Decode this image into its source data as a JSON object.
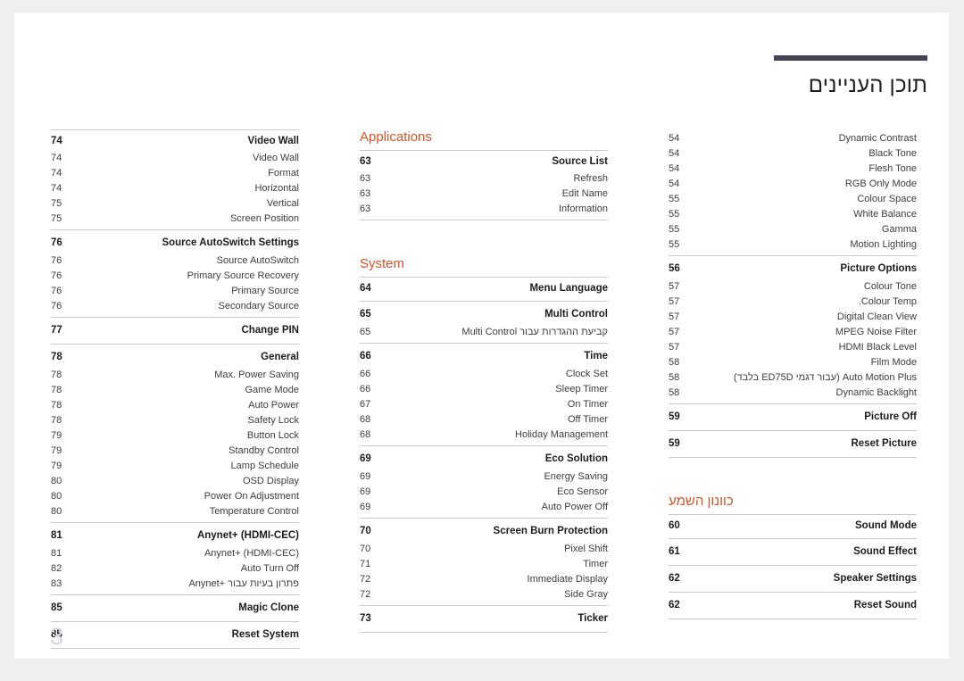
{
  "header": {
    "title": "תוכן העניינים"
  },
  "page_number": "3",
  "colors": {
    "accent": "#d0552a",
    "header_rule": "#454455",
    "text": "#333336",
    "rule": "#c9c9c9",
    "page_number": "#d5d7dc",
    "page_background": "#ffffff",
    "canvas_background": "#efefef"
  },
  "columns": [
    {
      "name": "left-column",
      "sections": [
        {
          "heading": null,
          "groups": [
            {
              "rows": [
                {
                  "page": "74",
                  "label": "Video Wall",
                  "bold": true
                },
                {
                  "page": "74",
                  "label": "Video Wall",
                  "bold": false
                },
                {
                  "page": "74",
                  "label": "Format",
                  "bold": false
                },
                {
                  "page": "74",
                  "label": "Horizontal",
                  "bold": false
                },
                {
                  "page": "75",
                  "label": "Vertical",
                  "bold": false
                },
                {
                  "page": "75",
                  "label": "Screen Position",
                  "bold": false
                }
              ]
            },
            {
              "rows": [
                {
                  "page": "76",
                  "label": "Source AutoSwitch Settings",
                  "bold": true
                },
                {
                  "page": "76",
                  "label": "Source AutoSwitch",
                  "bold": false
                },
                {
                  "page": "76",
                  "label": "Primary Source Recovery",
                  "bold": false
                },
                {
                  "page": "76",
                  "label": "Primary Source",
                  "bold": false
                },
                {
                  "page": "76",
                  "label": "Secondary Source",
                  "bold": false
                }
              ]
            },
            {
              "rows": [
                {
                  "page": "77",
                  "label": "Change PIN",
                  "bold": true
                }
              ]
            },
            {
              "rows": [
                {
                  "page": "78",
                  "label": "General",
                  "bold": true
                },
                {
                  "page": "78",
                  "label": "Max. Power Saving",
                  "bold": false
                },
                {
                  "page": "78",
                  "label": "Game Mode",
                  "bold": false
                },
                {
                  "page": "78",
                  "label": "Auto Power",
                  "bold": false
                },
                {
                  "page": "78",
                  "label": "Safety Lock",
                  "bold": false
                },
                {
                  "page": "79",
                  "label": "Button Lock",
                  "bold": false
                },
                {
                  "page": "79",
                  "label": "Standby Control",
                  "bold": false
                },
                {
                  "page": "79",
                  "label": "Lamp Schedule",
                  "bold": false
                },
                {
                  "page": "80",
                  "label": "OSD Display",
                  "bold": false
                },
                {
                  "page": "80",
                  "label": "Power On Adjustment",
                  "bold": false
                },
                {
                  "page": "80",
                  "label": "Temperature Control",
                  "bold": false
                }
              ]
            },
            {
              "rows": [
                {
                  "page": "81",
                  "label": "Anynet+ (HDMI-CEC)",
                  "bold": true
                },
                {
                  "page": "81",
                  "label": "Anynet+ (HDMI-CEC)",
                  "bold": false
                },
                {
                  "page": "82",
                  "label": "Auto Turn Off",
                  "bold": false
                },
                {
                  "page": "83",
                  "label": "פתרון בעיות עבור +Anynet",
                  "bold": false
                }
              ]
            },
            {
              "rows": [
                {
                  "page": "85",
                  "label": "Magic Clone",
                  "bold": true
                }
              ]
            },
            {
              "rows": [
                {
                  "page": "85",
                  "label": "Reset System",
                  "bold": true
                }
              ]
            }
          ]
        }
      ]
    },
    {
      "name": "middle-column",
      "sections": [
        {
          "heading": "Applications",
          "groups": [
            {
              "rows": [
                {
                  "page": "63",
                  "label": "Source List",
                  "bold": true
                },
                {
                  "page": "63",
                  "label": "Refresh",
                  "bold": false
                },
                {
                  "page": "63",
                  "label": "Edit Name",
                  "bold": false
                },
                {
                  "page": "63",
                  "label": "Information",
                  "bold": false
                }
              ]
            }
          ]
        },
        {
          "heading": "System",
          "groups": [
            {
              "rows": [
                {
                  "page": "64",
                  "label": "Menu Language",
                  "bold": true
                }
              ]
            },
            {
              "rows": [
                {
                  "page": "65",
                  "label": "Multi Control",
                  "bold": true
                },
                {
                  "page": "65",
                  "label": "קביעת ההגדרות עבור Multi Control",
                  "bold": false
                }
              ]
            },
            {
              "rows": [
                {
                  "page": "66",
                  "label": "Time",
                  "bold": true
                },
                {
                  "page": "66",
                  "label": "Clock Set",
                  "bold": false
                },
                {
                  "page": "66",
                  "label": "Sleep Timer",
                  "bold": false
                },
                {
                  "page": "67",
                  "label": "On Timer",
                  "bold": false
                },
                {
                  "page": "68",
                  "label": "Off Timer",
                  "bold": false
                },
                {
                  "page": "68",
                  "label": "Holiday Management",
                  "bold": false
                }
              ]
            },
            {
              "rows": [
                {
                  "page": "69",
                  "label": "Eco Solution",
                  "bold": true
                },
                {
                  "page": "69",
                  "label": "Energy Saving",
                  "bold": false
                },
                {
                  "page": "69",
                  "label": "Eco Sensor",
                  "bold": false
                },
                {
                  "page": "69",
                  "label": "Auto Power Off",
                  "bold": false
                }
              ]
            },
            {
              "rows": [
                {
                  "page": "70",
                  "label": "Screen Burn Protection",
                  "bold": true
                },
                {
                  "page": "70",
                  "label": "Pixel Shift",
                  "bold": false
                },
                {
                  "page": "71",
                  "label": "Timer",
                  "bold": false
                },
                {
                  "page": "72",
                  "label": "Immediate Display",
                  "bold": false
                },
                {
                  "page": "72",
                  "label": "Side Gray",
                  "bold": false
                }
              ]
            },
            {
              "rows": [
                {
                  "page": "73",
                  "label": "Ticker",
                  "bold": true
                }
              ]
            }
          ]
        }
      ]
    },
    {
      "name": "right-column",
      "sections": [
        {
          "heading": null,
          "no_top_rule": true,
          "groups": [
            {
              "no_top_rule": true,
              "rows": [
                {
                  "page": "54",
                  "label": "Dynamic Contrast",
                  "bold": false
                },
                {
                  "page": "54",
                  "label": "Black Tone",
                  "bold": false
                },
                {
                  "page": "54",
                  "label": "Flesh Tone",
                  "bold": false
                },
                {
                  "page": "54",
                  "label": "RGB Only Mode",
                  "bold": false
                },
                {
                  "page": "55",
                  "label": "Colour Space",
                  "bold": false
                },
                {
                  "page": "55",
                  "label": "White Balance",
                  "bold": false
                },
                {
                  "page": "55",
                  "label": "Gamma",
                  "bold": false
                },
                {
                  "page": "55",
                  "label": "Motion Lighting",
                  "bold": false
                }
              ]
            },
            {
              "rows": [
                {
                  "page": "56",
                  "label": "Picture Options",
                  "bold": true
                },
                {
                  "page": "57",
                  "label": "Colour Tone",
                  "bold": false
                },
                {
                  "page": "57",
                  "label": "Colour Temp.",
                  "bold": false
                },
                {
                  "page": "57",
                  "label": "Digital Clean View",
                  "bold": false
                },
                {
                  "page": "57",
                  "label": "MPEG Noise Filter",
                  "bold": false
                },
                {
                  "page": "57",
                  "label": "HDMI Black Level",
                  "bold": false
                },
                {
                  "page": "58",
                  "label": "Film Mode",
                  "bold": false
                },
                {
                  "page": "58",
                  "label": "Auto Motion Plus (עבור דגמי ED75D בלבד)",
                  "bold": false
                },
                {
                  "page": "58",
                  "label": "Dynamic Backlight",
                  "bold": false
                }
              ]
            },
            {
              "rows": [
                {
                  "page": "59",
                  "label": "Picture Off",
                  "bold": true
                }
              ]
            },
            {
              "rows": [
                {
                  "page": "59",
                  "label": "Reset Picture",
                  "bold": true
                }
              ]
            }
          ]
        },
        {
          "heading": "כוונון השמע",
          "groups": [
            {
              "rows": [
                {
                  "page": "60",
                  "label": "Sound Mode",
                  "bold": true
                }
              ]
            },
            {
              "rows": [
                {
                  "page": "61",
                  "label": "Sound Effect",
                  "bold": true
                }
              ]
            },
            {
              "rows": [
                {
                  "page": "62",
                  "label": "Speaker Settings",
                  "bold": true
                }
              ]
            },
            {
              "rows": [
                {
                  "page": "62",
                  "label": "Reset Sound",
                  "bold": true
                }
              ]
            }
          ]
        }
      ]
    }
  ]
}
